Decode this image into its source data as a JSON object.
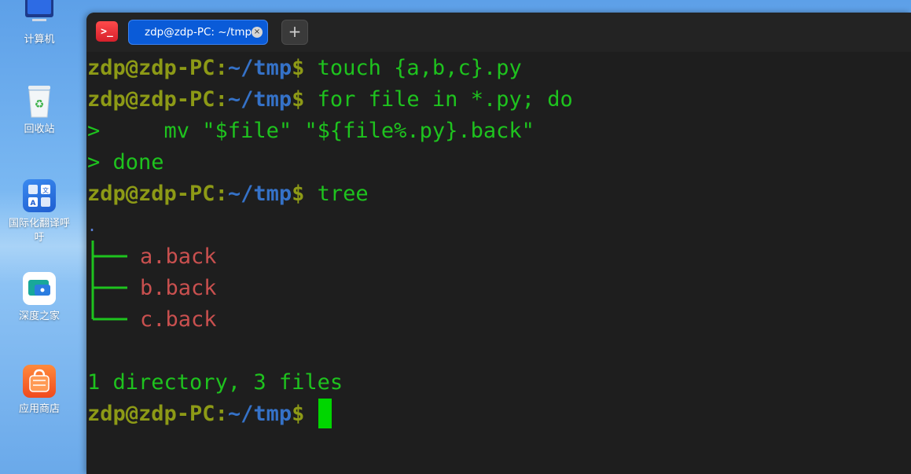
{
  "desktop": {
    "icons": [
      {
        "label": "计算机",
        "icon": "computer-icon"
      },
      {
        "label": "回收站",
        "icon": "trash-icon"
      },
      {
        "label": "国际化翻译呼吁",
        "icon": "translate-icon"
      },
      {
        "label": "深度之家",
        "icon": "deepin-home-icon"
      },
      {
        "label": "应用商店",
        "icon": "app-store-icon"
      }
    ]
  },
  "terminal": {
    "tab_title": "zdp@zdp-PC: ~/tmp",
    "tab_close_glyph": "×",
    "add_tab_glyph": "+",
    "app_icon_glyph": ">_",
    "prompt": {
      "user_host": "zdp@zdp-PC",
      "colon": ":",
      "path": "~/tmp",
      "dollar": "$"
    },
    "commands": {
      "cmd1": " touch {a,b,c}.py",
      "cmd2": " for file in *.py; do",
      "cont1": ">     mv \"$file\" \"${file%.py}.back\"",
      "cont2": "> done",
      "cmd3": " tree"
    },
    "tree": {
      "root": ".",
      "files": [
        "a.back",
        "b.back",
        "c.back"
      ]
    },
    "summary": "1 directory, 3 files",
    "colors": {
      "prompt_user": "#8d9a16",
      "prompt_path": "#3572c8",
      "command": "#1ec31e",
      "file": "#c9504f",
      "cursor": "#00d600"
    }
  }
}
